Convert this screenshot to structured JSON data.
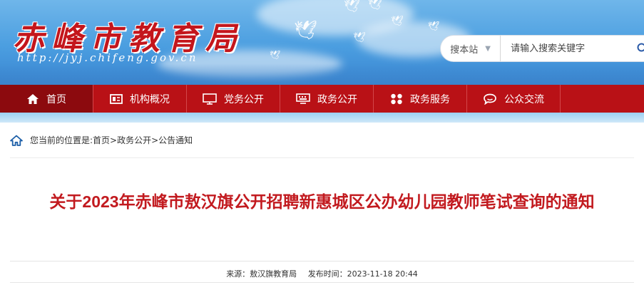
{
  "header": {
    "site_title": "赤峰市教育局",
    "site_url": "http://jyj.chifeng.gov.cn"
  },
  "search": {
    "scope_label": "搜本站",
    "placeholder": "请输入搜索关键字",
    "scope_icon": "chevron-down-icon",
    "button_icon": "search-icon"
  },
  "nav": {
    "items": [
      {
        "label": "首页",
        "icon": "home-icon"
      },
      {
        "label": "机构概况",
        "icon": "org-icon"
      },
      {
        "label": "党务公开",
        "icon": "monitor-icon"
      },
      {
        "label": "政务公开",
        "icon": "keyboard-icon"
      },
      {
        "label": "政务服务",
        "icon": "service-icon"
      },
      {
        "label": "公众交流",
        "icon": "chat-icon"
      }
    ],
    "active_index": 0
  },
  "breadcrumb": {
    "text": "您当前的位置是:首页>政务公开>公告通知"
  },
  "article": {
    "title": "关于2023年赤峰市敖汉旗公开招聘新惠城区公办幼儿园教师笔试查询的通知",
    "source": "来源：敖汉旗教育局",
    "published": "发布时间：2023-11-18 20:44"
  },
  "colors": {
    "nav_bg": "#b91116",
    "nav_active": "#8c0a0e",
    "title_red": "#c21a1f",
    "banner_blue": "#4b9ee0"
  }
}
